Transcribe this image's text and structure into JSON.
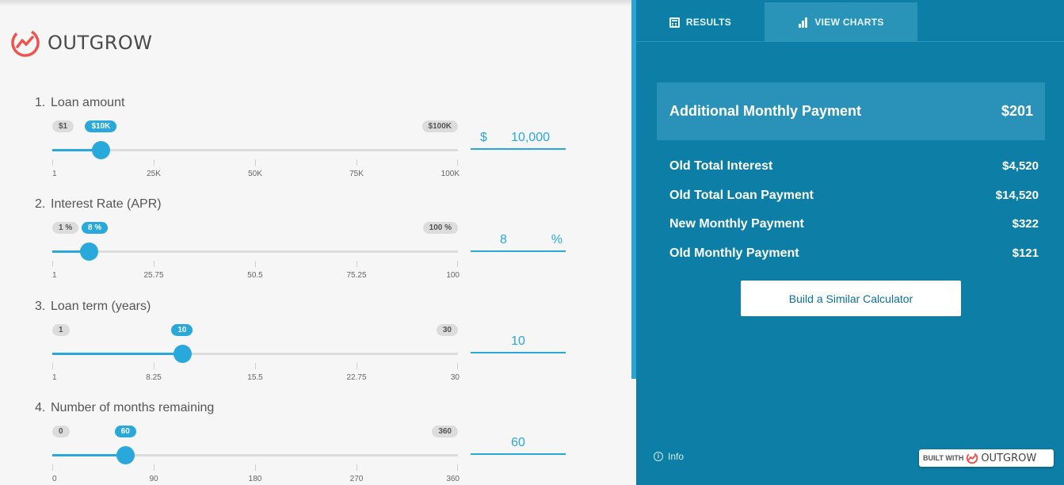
{
  "brand": {
    "name": "OUTGROW",
    "accent": "#29a8dc",
    "panel_bg": "#0d7fa6",
    "logo_color": "#ef5350",
    "logo_icon": "outgrow-logo-icon"
  },
  "questions": [
    {
      "number": "1.",
      "label": "Loan amount",
      "min_label": "$1",
      "current_label": "$10K",
      "max_label": "$100K",
      "ticks": [
        "1",
        "25K",
        "50K",
        "75K",
        "100K"
      ],
      "fraction": 0.12,
      "input_prefix": "$",
      "input_value": "10,000"
    },
    {
      "number": "2.",
      "label": "Interest Rate (APR)",
      "min_label": "1 %",
      "current_label": "8 %",
      "max_label": "100 %",
      "ticks": [
        "1",
        "25.75",
        "50.5",
        "75.25",
        "100"
      ],
      "fraction": 0.09,
      "input_value": "8",
      "input_suffix": "%"
    },
    {
      "number": "3.",
      "label": "Loan term (years)",
      "min_label": "1",
      "current_label": "10",
      "max_label": "30",
      "ticks": [
        "1",
        "8.25",
        "15.5",
        "22.75",
        "30"
      ],
      "fraction": 0.32,
      "input_value": "10"
    },
    {
      "number": "4.",
      "label": "Number of months remaining",
      "min_label": "0",
      "current_label": "60",
      "max_label": "360",
      "ticks": [
        "0",
        "90",
        "180",
        "270",
        "360"
      ],
      "fraction": 0.18,
      "input_value": "60"
    }
  ],
  "tabs": [
    {
      "label": "RESULTS",
      "icon": "calculator-icon",
      "active": true
    },
    {
      "label": "VIEW CHARTS",
      "icon": "bar-chart-icon",
      "active": false
    }
  ],
  "results": {
    "highlight": {
      "label": "Additional Monthly Payment",
      "value": "$201"
    },
    "rows": [
      {
        "label": "Old Total Interest",
        "value": "$4,520"
      },
      {
        "label": "Old Total Loan Payment",
        "value": "$14,520"
      },
      {
        "label": "New Monthly Payment",
        "value": "$322"
      },
      {
        "label": "Old Monthly Payment",
        "value": "$121"
      }
    ],
    "build_button": "Build a Similar Calculator"
  },
  "footer": {
    "info_label": "Info",
    "built_with": "BUILT WITH",
    "built_brand": "OUTGROW"
  }
}
